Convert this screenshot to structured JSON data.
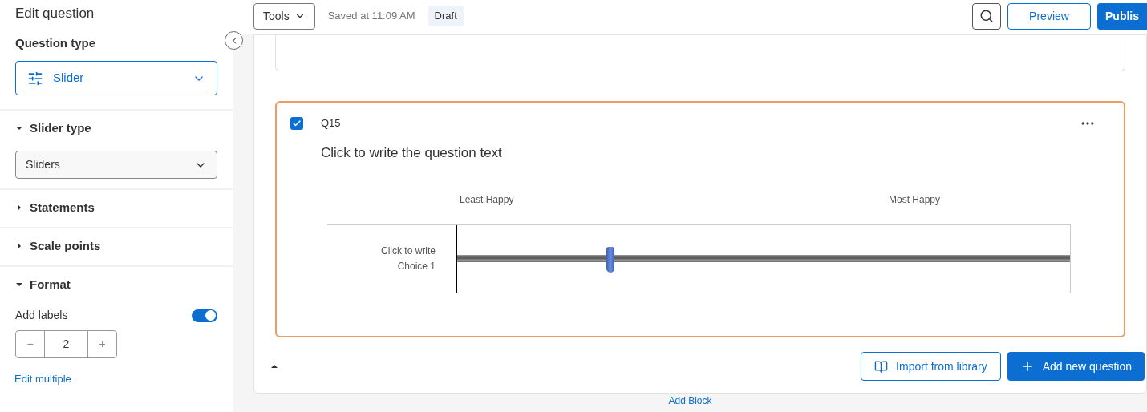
{
  "sidebar": {
    "title": "Edit question",
    "question_type": {
      "label": "Question type",
      "value": "Slider"
    },
    "sections": [
      {
        "kind": "select",
        "title": "Slider type",
        "expanded": true,
        "value": "Sliders"
      },
      {
        "title": "Statements",
        "expanded": false
      },
      {
        "title": "Scale points",
        "expanded": false
      },
      {
        "kind": "format",
        "title": "Format",
        "expanded": true,
        "toggle_label": "Add labels",
        "toggle_on": true,
        "stepper_value": "2",
        "minus": "−",
        "plus": "+"
      }
    ],
    "link": "Edit multiple"
  },
  "toolbar": {
    "tools": "Tools",
    "saved": "Saved at 11:09 AM",
    "status": "Draft",
    "preview": "Preview",
    "publish": "Publis"
  },
  "question": {
    "checked": true,
    "id": "Q15",
    "text": "Click to write the question text",
    "labels": [
      "Least Happy",
      "Most Happy"
    ],
    "rows": [
      {
        "label": "Click to write Choice 1",
        "level": 0.25
      }
    ]
  },
  "actions": {
    "import": "Import from library",
    "add": "Add new question"
  },
  "add_block": "Add Block"
}
